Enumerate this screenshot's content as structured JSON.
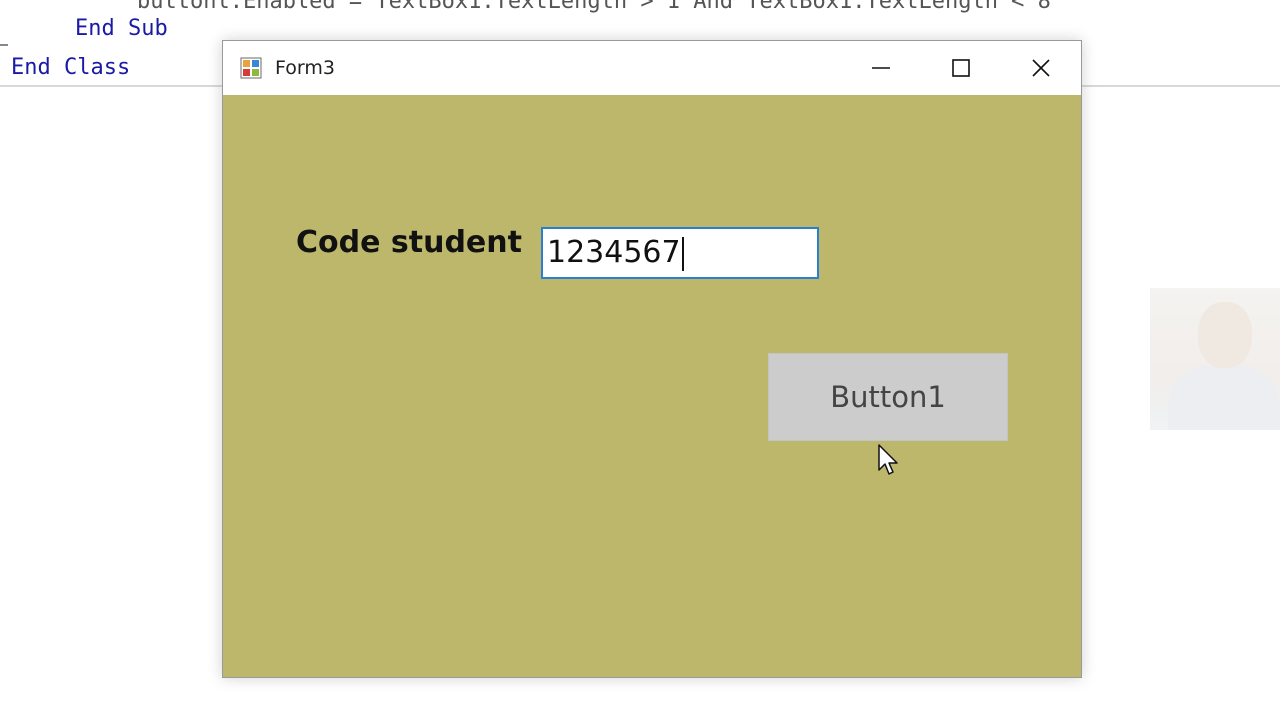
{
  "editor": {
    "cutoff_line": "buttonl.Enabled = TextBox1.TextLength > 1 And TextBox1.TextLength < 8",
    "end_sub": "End Sub",
    "end_class": "End Class"
  },
  "window": {
    "title": "Form3",
    "icon": "winforms-app-icon",
    "controls": [
      "minimize-icon",
      "maximize-icon",
      "close-icon"
    ],
    "background_color": "#bdb76b"
  },
  "form": {
    "label": "Code student",
    "textbox_value": "1234567",
    "button_label": "Button1",
    "accent_color": "#2a7fd4"
  },
  "overlay": {
    "cursor": "arrow-cursor-icon",
    "webcam": "presenter-webcam"
  }
}
